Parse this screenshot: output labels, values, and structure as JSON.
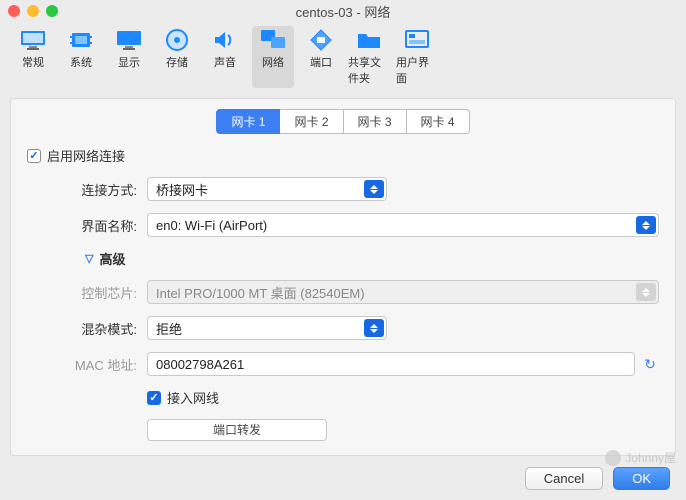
{
  "window": {
    "title": "centos-03 - 网络"
  },
  "toolbar": {
    "items": [
      {
        "label": "常规"
      },
      {
        "label": "系统"
      },
      {
        "label": "显示"
      },
      {
        "label": "存储"
      },
      {
        "label": "声音"
      },
      {
        "label": "网络"
      },
      {
        "label": "端口"
      },
      {
        "label": "共享文件夹"
      },
      {
        "label": "用户界面"
      }
    ],
    "selectedIndex": 5
  },
  "tabs": {
    "items": [
      "网卡 1",
      "网卡 2",
      "网卡 3",
      "网卡 4"
    ],
    "activeIndex": 0
  },
  "form": {
    "enable_label": "启用网络连接",
    "enable_checked": true,
    "attach_label": "连接方式:",
    "attach_value": "桥接网卡",
    "iface_label": "界面名称:",
    "iface_value": "en0: Wi-Fi (AirPort)",
    "advanced_label": "高级",
    "chip_label": "控制芯片:",
    "chip_value": "Intel PRO/1000 MT 桌面 (82540EM)",
    "promisc_label": "混杂模式:",
    "promisc_value": "拒绝",
    "mac_label": "MAC 地址:",
    "mac_value": "08002798A261",
    "cable_label": "接入网线",
    "cable_checked": true,
    "portfwd_label": "端口转发"
  },
  "footer": {
    "cancel": "Cancel",
    "ok": "OK"
  },
  "watermark": {
    "text": "Johnny屋"
  }
}
